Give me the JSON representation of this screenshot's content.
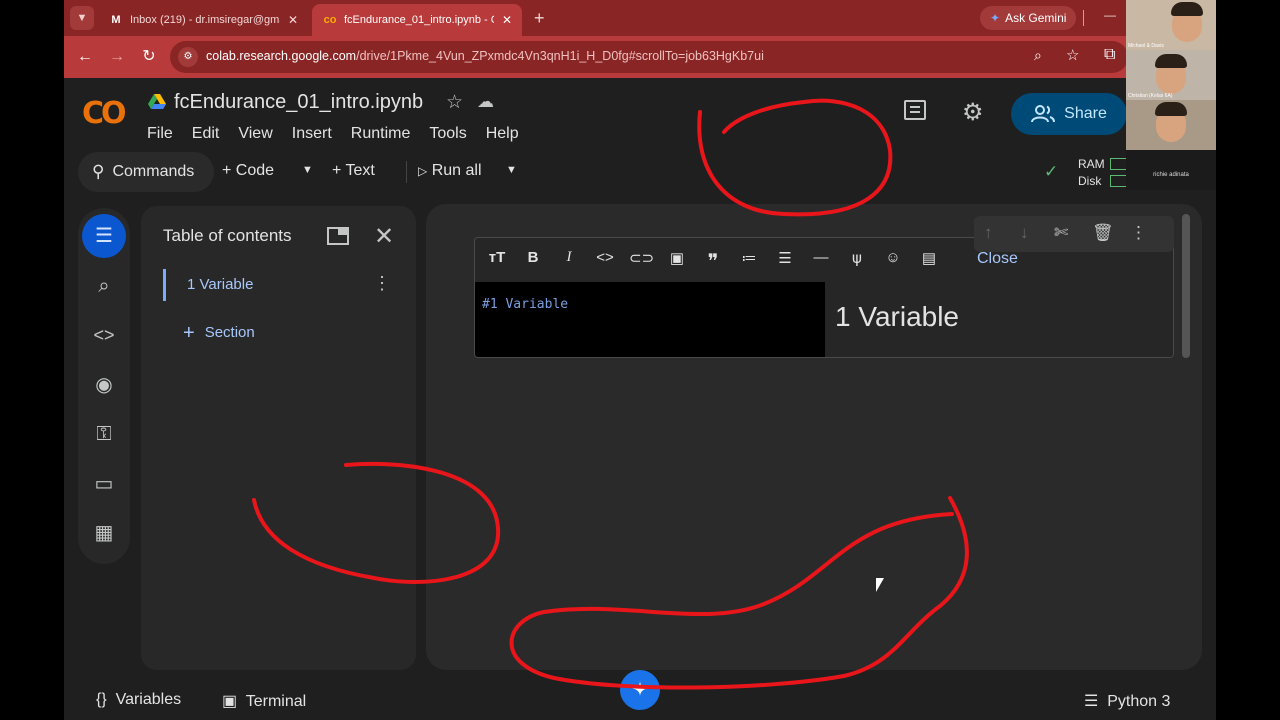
{
  "browser": {
    "tabs": [
      {
        "title": "Inbox (219) - dr.imsiregar@gma",
        "favicon": "gmail-icon",
        "active": false
      },
      {
        "title": "fcEndurance_01_intro.ipynb - Co",
        "favicon": "colab-icon",
        "active": true
      }
    ],
    "ask_gemini": "Ask Gemini",
    "url_host": "colab.research.google.com",
    "url_path": "/drive/1Pkme_4Vun_ZPxmdc4Vn3qnH1i_H_D0fg#scrollTo=job63HgKb7ui",
    "accent_color": "#b83a3a"
  },
  "header": {
    "logo": "CO",
    "notebook_title": "fcEndurance_01_intro.ipynb",
    "menu": [
      "File",
      "Edit",
      "View",
      "Insert",
      "Runtime",
      "Tools",
      "Help"
    ],
    "share_label": "Share"
  },
  "toolbar": {
    "commands": "Commands",
    "code": "Code",
    "text": "Text",
    "run_all": "Run all",
    "ram": "RAM",
    "disk": "Disk"
  },
  "toc": {
    "title": "Table of contents",
    "items": [
      {
        "label": "1 Variable"
      }
    ],
    "add_section": "Section"
  },
  "cell": {
    "source": "#1 Variable",
    "rendered_heading": "1 Variable",
    "close_label": "Close"
  },
  "bottom": {
    "variables": "Variables",
    "terminal": "Terminal",
    "kernel": "Python 3"
  },
  "video_call": {
    "participants": [
      "Michael & Davis",
      "Christian (Kelas 6A)",
      "",
      "richie adinata"
    ]
  },
  "annotation_color": "#e8161a"
}
